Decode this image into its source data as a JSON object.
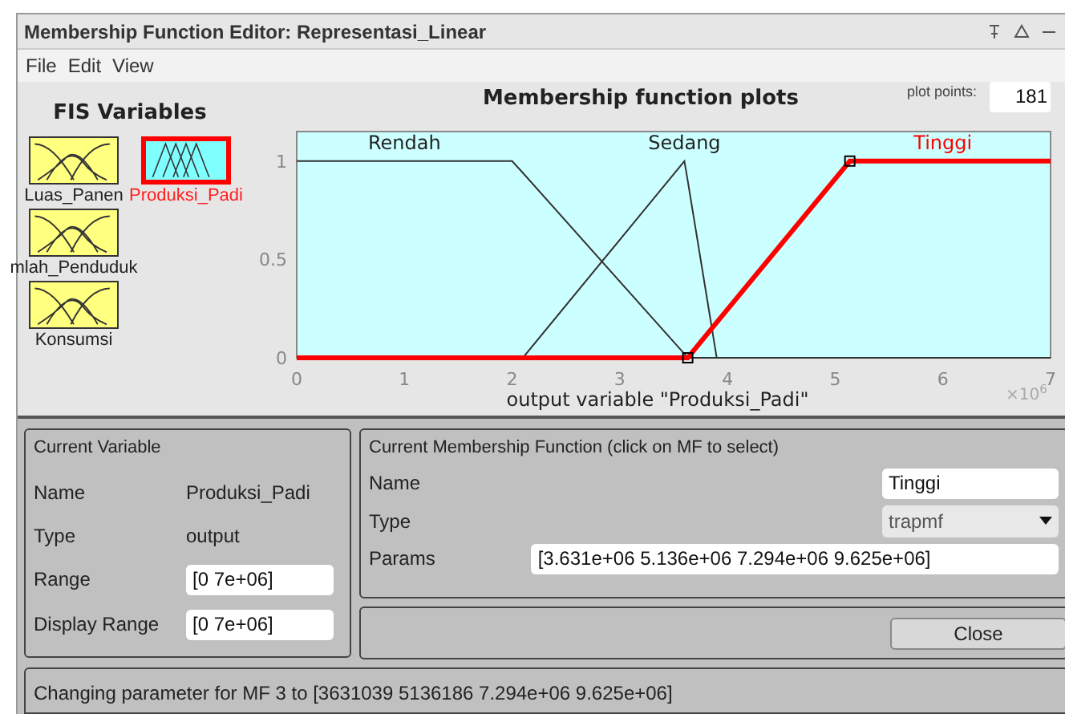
{
  "window": {
    "title": "Membership Function Editor: Representasi_Linear"
  },
  "menu": [
    "File",
    "Edit",
    "View"
  ],
  "fis_variables": {
    "title": "FIS Variables",
    "items": [
      {
        "label": "Luas_Panen",
        "selected": false
      },
      {
        "label": "Produksi_Padi",
        "selected": true
      },
      {
        "label": "mlah_Penduduk",
        "selected": false
      },
      {
        "label": "Konsumsi",
        "selected": false
      }
    ]
  },
  "plot": {
    "title": "Membership function plots",
    "plot_points_label": "plot points:",
    "plot_points": "181",
    "chart_data": {
      "type": "line",
      "xlabel": "output variable \"Produksi_Padi\"",
      "x": [
        0,
        2,
        2.1,
        3.6,
        3.631,
        3.9,
        5.136,
        7
      ],
      "xlim": [
        0,
        7
      ],
      "ylim": [
        0,
        1.15
      ],
      "xticks": [
        0,
        1,
        2,
        3,
        4,
        5,
        6,
        7
      ],
      "yticks": [
        0,
        0.5,
        1
      ],
      "series": [
        {
          "name": "Rendah",
          "color": "#333333",
          "values": [
            1,
            1,
            0.94,
            0.02,
            0,
            0,
            0,
            0
          ]
        },
        {
          "name": "Sedang",
          "color": "#333333",
          "values": [
            0,
            0,
            0,
            1,
            0.9,
            0,
            0,
            0
          ]
        },
        {
          "name": "Tinggi",
          "color": "#ff0000",
          "values": [
            0,
            0,
            0,
            0,
            0,
            0.18,
            1,
            1
          ]
        }
      ],
      "annotations": [
        "×10$^{6}$"
      ]
    }
  },
  "current_variable": {
    "title": "Current Variable",
    "name_label": "Name",
    "name": "Produksi_Padi",
    "type_label": "Type",
    "type": "output",
    "range_label": "Range",
    "range": "[0 7e+06]",
    "display_range_label": "Display Range",
    "display_range": "[0 7e+06]"
  },
  "current_mf": {
    "title": "Current Membership Function (click on MF to select)",
    "name_label": "Name",
    "name": "Tinggi",
    "type_label": "Type",
    "type": "trapmf",
    "params_label": "Params",
    "params": "[3.631e+06 5.136e+06 7.294e+06 9.625e+06]"
  },
  "close_button": "Close",
  "status": "Changing parameter for MF 3 to  [3631039 5136186 7.294e+06 9.625e+06]"
}
